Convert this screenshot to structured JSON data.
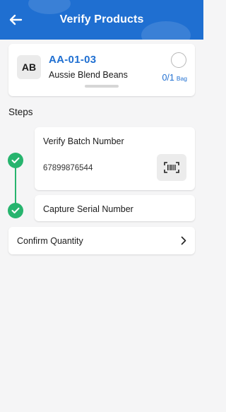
{
  "header": {
    "title": "Verify Products",
    "back_icon": "arrow-left-icon",
    "background_color": "#1f6fd1"
  },
  "product": {
    "avatar_initials": "AB",
    "code": "AA-01-03",
    "name": "Aussie Blend Beans",
    "quantity": "0/1",
    "unit": "Bag",
    "accent_color": "#1f6fd1"
  },
  "steps": {
    "heading": "Steps",
    "items": [
      {
        "title": "Verify Batch Number",
        "value": "67899876544",
        "status": "completed",
        "action_icon": "barcode-scan-icon"
      },
      {
        "title": "Capture Serial Number",
        "status": "completed"
      }
    ],
    "complete_color": "#27b46e"
  },
  "confirm_quantity": {
    "label": "Confirm Quantity",
    "icon": "chevron-right-icon"
  }
}
